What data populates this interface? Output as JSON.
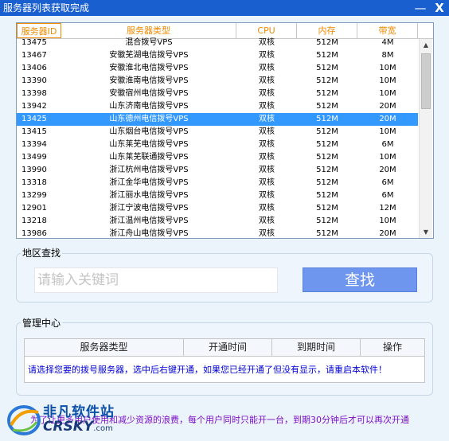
{
  "window": {
    "title": "服务器列表获取完成",
    "minimize_label": "—",
    "close_label": "X"
  },
  "table": {
    "columns": [
      "服务器ID",
      "服务器类型",
      "CPU",
      "内存",
      "带宽"
    ],
    "rows": [
      {
        "id": "13475",
        "type": "混合拨号VPS",
        "cpu": "双核",
        "mem": "512M",
        "bw": "4M"
      },
      {
        "id": "13467",
        "type": "安徽芜湖电信拨号VPS",
        "cpu": "双核",
        "mem": "512M",
        "bw": "8M"
      },
      {
        "id": "13406",
        "type": "安徽淮北电信拨号VPS",
        "cpu": "双核",
        "mem": "512M",
        "bw": "10M"
      },
      {
        "id": "13390",
        "type": "安徽淮南电信拨号VPS",
        "cpu": "双核",
        "mem": "512M",
        "bw": "10M"
      },
      {
        "id": "13398",
        "type": "安徽宿州电信拨号VPS",
        "cpu": "双核",
        "mem": "512M",
        "bw": "10M"
      },
      {
        "id": "13942",
        "type": "山东济南电信拨号VPS",
        "cpu": "双核",
        "mem": "512M",
        "bw": "20M"
      },
      {
        "id": "13425",
        "type": "山东德州电信拨号VPS",
        "cpu": "双核",
        "mem": "512M",
        "bw": "20M",
        "selected": true
      },
      {
        "id": "13415",
        "type": "山东烟台电信拨号VPS",
        "cpu": "双核",
        "mem": "512M",
        "bw": "10M"
      },
      {
        "id": "13394",
        "type": "山东莱芜电信拨号VPS",
        "cpu": "双核",
        "mem": "512M",
        "bw": "6M"
      },
      {
        "id": "13499",
        "type": "山东莱芜联通拨号VPS",
        "cpu": "双核",
        "mem": "512M",
        "bw": "10M"
      },
      {
        "id": "13990",
        "type": "浙江杭州电信拨号VPS",
        "cpu": "双核",
        "mem": "512M",
        "bw": "20M"
      },
      {
        "id": "13318",
        "type": "浙江金华电信拨号VPS",
        "cpu": "双核",
        "mem": "512M",
        "bw": "6M"
      },
      {
        "id": "13299",
        "type": "浙江丽水电信拨号VPS",
        "cpu": "双核",
        "mem": "512M",
        "bw": "6M"
      },
      {
        "id": "12901",
        "type": "浙江宁波电信拨号VPS",
        "cpu": "双核",
        "mem": "512M",
        "bw": "12M"
      },
      {
        "id": "13218",
        "type": "浙江温州电信拨号VPS",
        "cpu": "双核",
        "mem": "512M",
        "bw": "10M"
      },
      {
        "id": "13986",
        "type": "浙江舟山电信拨号VPS",
        "cpu": "双核",
        "mem": "512M",
        "bw": "20M"
      }
    ]
  },
  "region_search": {
    "group_label": "地区查找",
    "placeholder": "请输入关键词",
    "button_label": "查找"
  },
  "management": {
    "group_label": "管理中心",
    "columns": [
      "服务器类型",
      "开通时间",
      "到期时间",
      "操作"
    ],
    "message": "请选择您要的拨号服务器，选中后右键开通，如果您已经开通了但没有显示，请重启本软件！"
  },
  "footer_notice": "为了让更多用户使用和减少资源的浪费，每个用户同时只能开一台，到期30分钟后才可以再次开通",
  "watermark": {
    "line1": "非凡软件站",
    "line2": "CRSKY",
    "line2_suffix": ".com"
  },
  "colors": {
    "titlebar": "#1a5fd0",
    "header_text": "#f08a00",
    "selected_row": "#3399ff",
    "search_button": "#6f96ee",
    "message_text": "#0000d8",
    "notice_text": "#7a10c8"
  }
}
